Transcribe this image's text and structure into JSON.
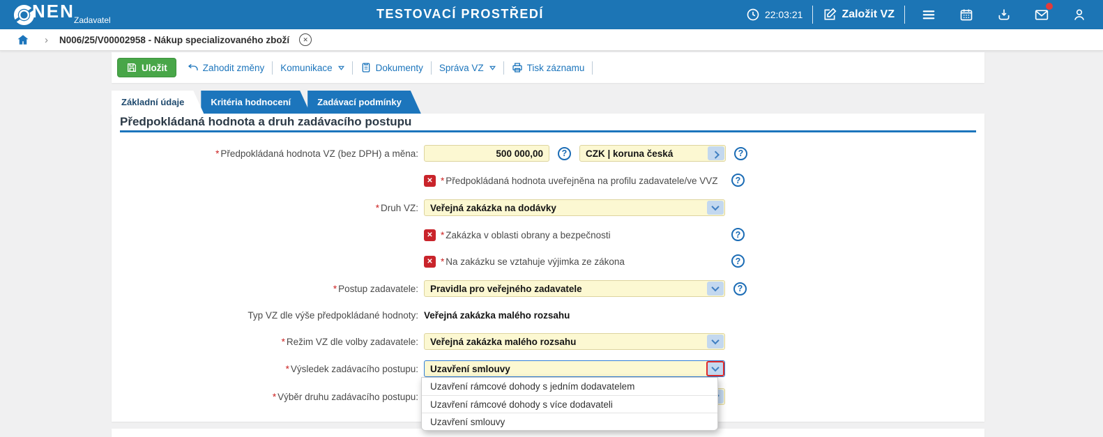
{
  "header": {
    "logo_text": "NEN",
    "logo_subtitle": "Zadavatel",
    "title": "TESTOVACÍ PROSTŘEDÍ",
    "time": "22:03:21",
    "create_vz_label": "Založit VZ"
  },
  "breadcrumb": {
    "chevron_glyph": "›",
    "item": "N006/25/V00002958 - Nákup specializovaného zboží",
    "close_glyph": "✕"
  },
  "toolbar": {
    "save_label": "Uložit",
    "discard_label": "Zahodit změny",
    "communication_label": "Komunikace",
    "documents_label": "Dokumenty",
    "manage_label": "Správa VZ",
    "print_label": "Tisk záznamu"
  },
  "tabs": [
    {
      "label": "Základní údaje",
      "active": true
    },
    {
      "label": "Kritéria hodnocení",
      "active": false
    },
    {
      "label": "Zadávací podmínky",
      "active": false
    }
  ],
  "section": {
    "heading": "Předpokládaná hodnota a druh zadávacího postupu"
  },
  "glyphs": {
    "required_mark": "*",
    "help": "?",
    "unchecked": "✕"
  },
  "form": {
    "estimated_value": {
      "label": "Předpokládaná hodnota VZ (bez DPH) a měna:",
      "value": "500 000,00",
      "currency": "CZK | koruna česká"
    },
    "published": {
      "label": "Předpokládaná hodnota uveřejněna na profilu zadavatele/ve VVZ",
      "checked": false
    },
    "kind": {
      "label": "Druh VZ:",
      "value": "Veřejná zakázka na dodávky"
    },
    "defense": {
      "label": "Zakázka v oblasti obrany a bezpečnosti",
      "checked": false
    },
    "exception": {
      "label": "Na zakázku se vztahuje výjimka ze zákona",
      "checked": false
    },
    "procedure": {
      "label": "Postup zadavatele:",
      "value": "Pravidla pro veřejného zadavatele"
    },
    "type_by_value": {
      "label": "Typ VZ dle výše předpokládané hodnoty:",
      "value": "Veřejná zakázka malého rozsahu"
    },
    "regime": {
      "label": "Režim VZ dle volby zadavatele:",
      "value": "Veřejná zakázka malého rozsahu"
    },
    "result": {
      "label": "Výsledek zadávacího postupu:",
      "value": "Uzavření smlouvy"
    },
    "procedure_type": {
      "label": "Výběr druhu zadávacího postupu:"
    }
  },
  "dropdown": {
    "options": [
      "Uzavření rámcové dohody s jedním dodavatelem",
      "Uzavření rámcové dohody s více dodavateli",
      "Uzavření smlouvy"
    ]
  },
  "colors": {
    "header_blue": "#1c75b5",
    "accent_blue": "#1c75bc",
    "save_green": "#48a648",
    "field_yellow": "#fcf8d2",
    "required_red": "#cc2222",
    "checkbox_red": "#c9242b",
    "notification_red": "#e23b3b"
  }
}
